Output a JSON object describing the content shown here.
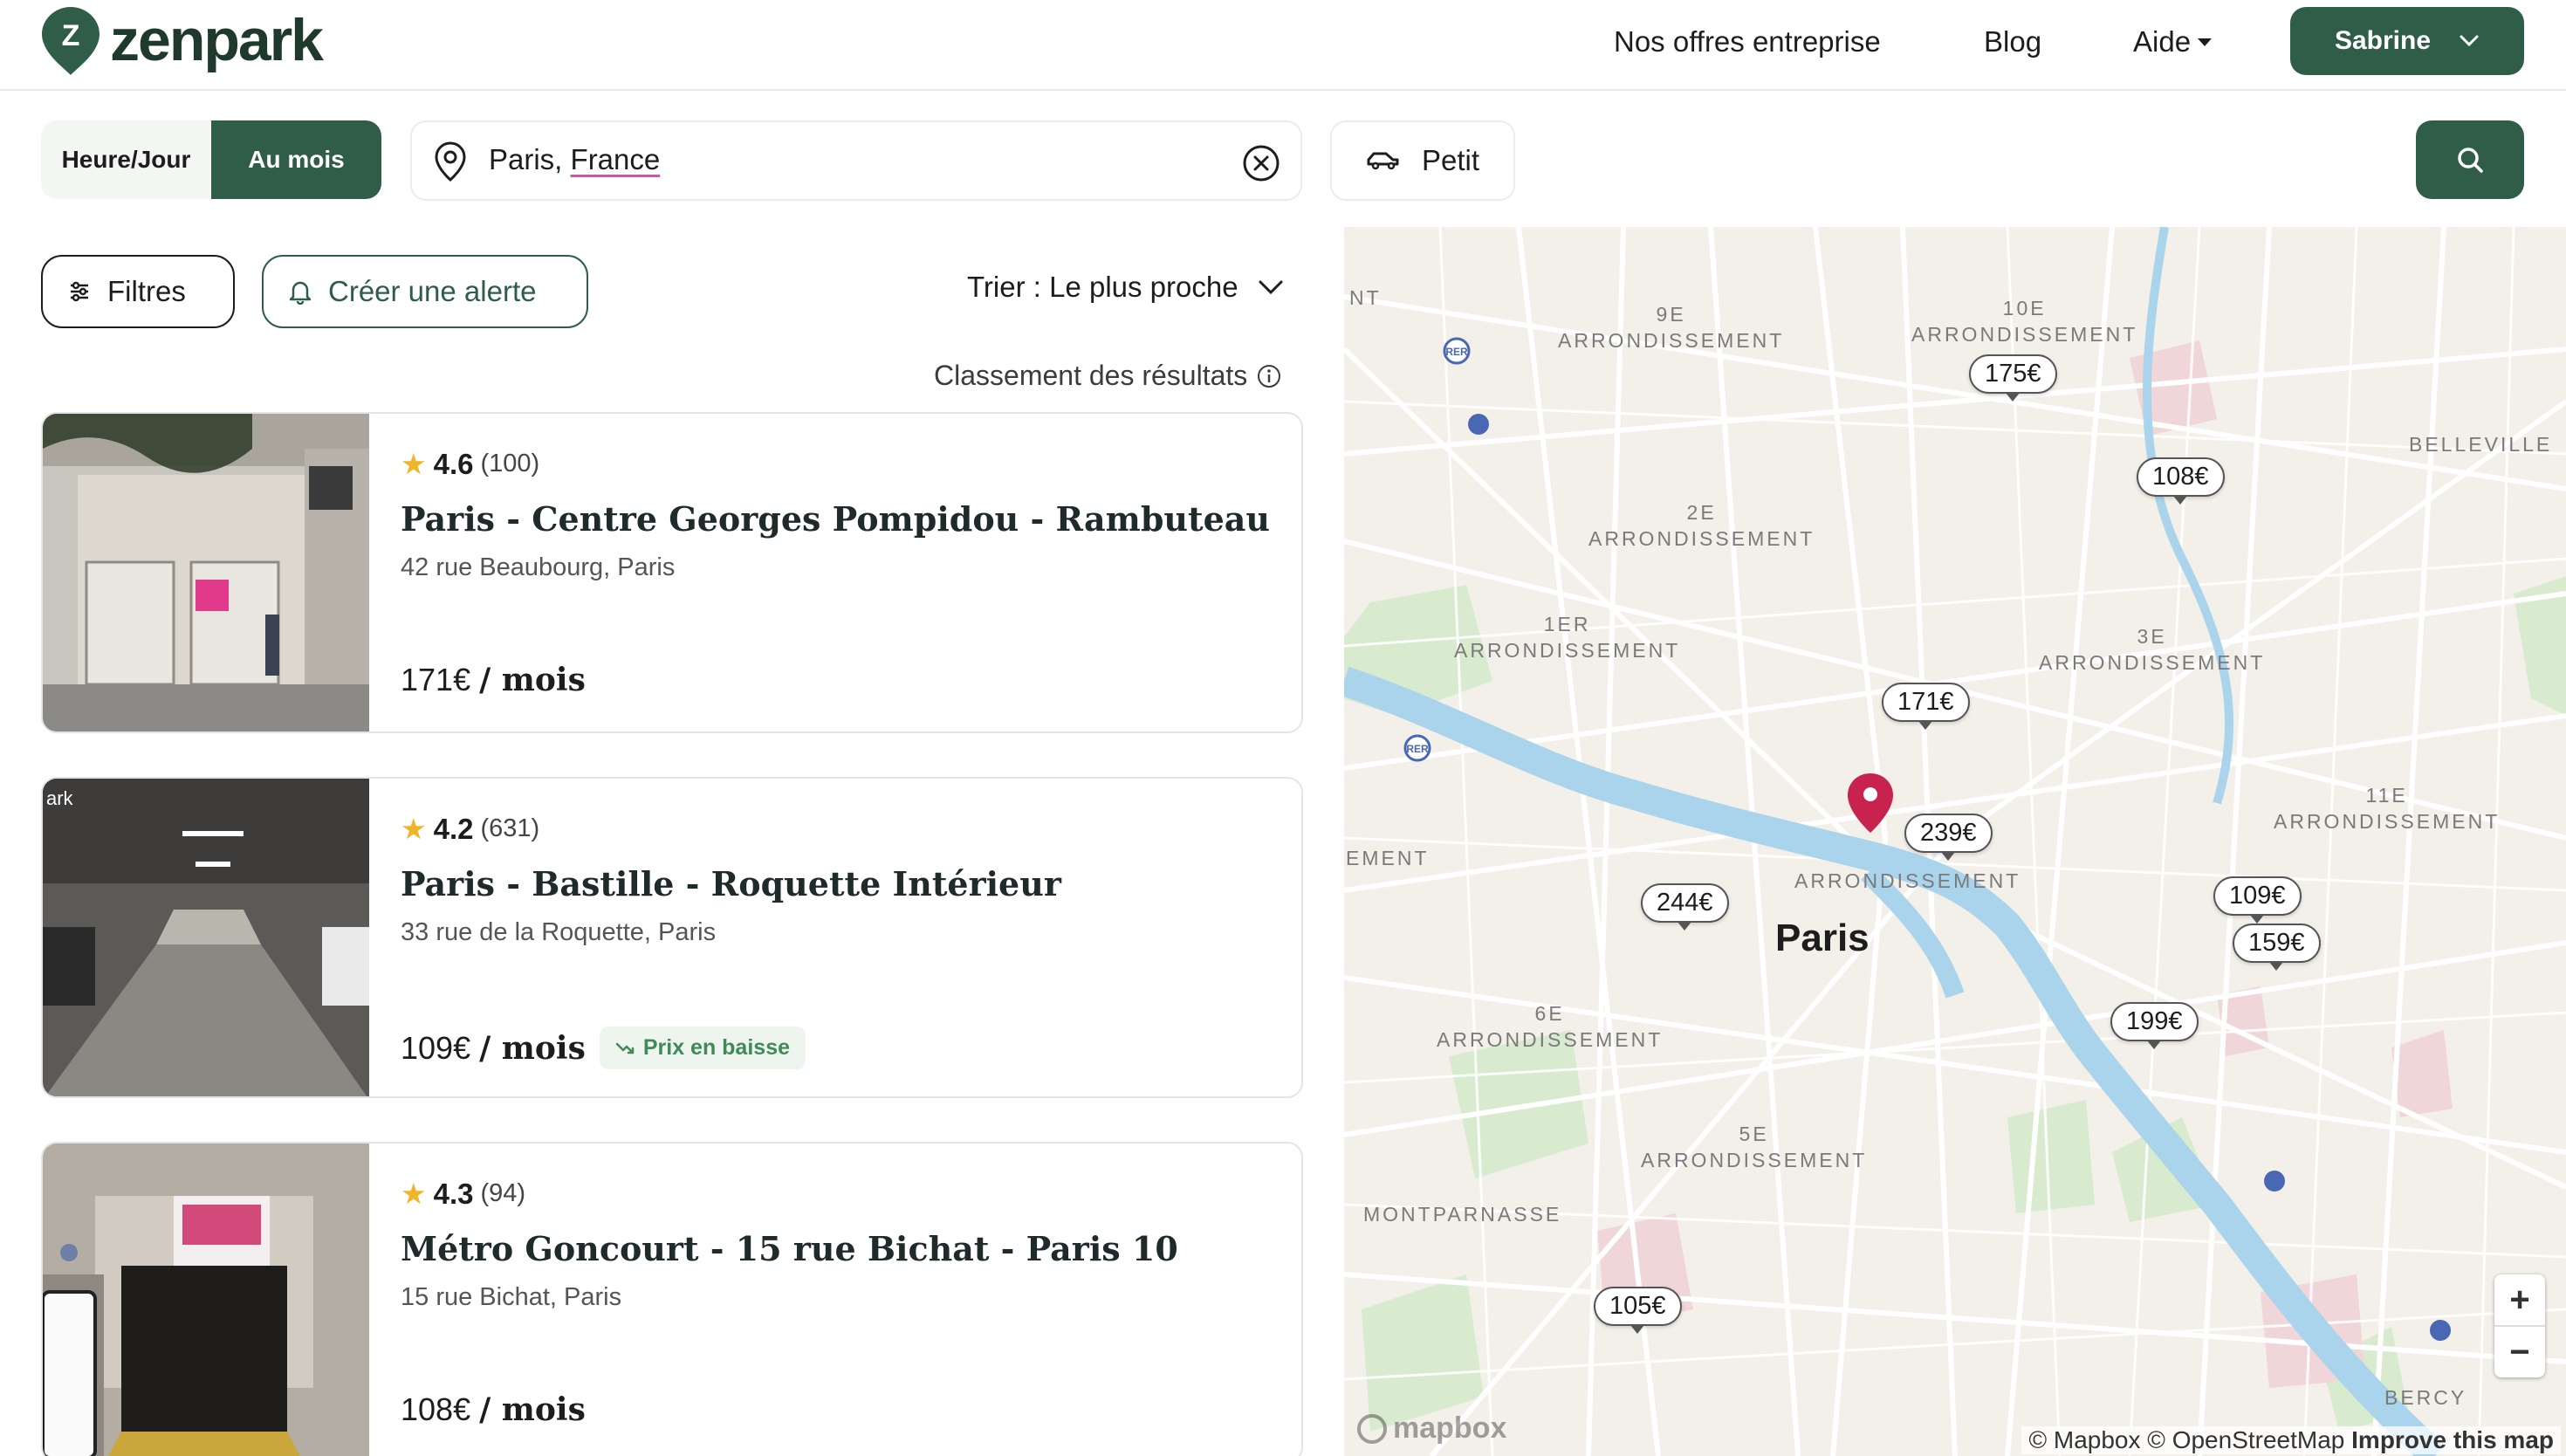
{
  "header": {
    "brand": "zenpark",
    "brand_letter": "Z",
    "nav": [
      "Nos offres entreprise",
      "Blog",
      "Aide"
    ],
    "user_name": "Sabrine"
  },
  "search": {
    "mode_hour": "Heure/Jour",
    "mode_month": "Au mois",
    "active_mode": "Au mois",
    "location_city": "Paris,",
    "location_country": "France",
    "vehicle": "Petit"
  },
  "filters": {
    "filters_label": "Filtres",
    "alert_label": "Créer une alerte",
    "sort_label": "Trier : Le plus proche",
    "ranking_label": "Classement des résultats"
  },
  "results": [
    {
      "rating": "4.6",
      "count": "(100)",
      "title": "Paris - Centre Georges Pompidou - Rambuteau",
      "address": "42 rue Beaubourg, Paris",
      "price": "171€",
      "per": "/ mois",
      "badge": ""
    },
    {
      "rating": "4.2",
      "count": "(631)",
      "title": "Paris - Bastille - Roquette Intérieur",
      "address": "33 rue de la Roquette, Paris",
      "price": "109€",
      "per": "/ mois",
      "badge": "Prix en baisse"
    },
    {
      "rating": "4.3",
      "count": "(94)",
      "title": "Métro Goncourt - 15 rue Bichat - Paris 10",
      "address": "15 rue Bichat, Paris",
      "price": "108€",
      "per": "/ mois",
      "badge": ""
    }
  ],
  "map": {
    "city": "Paris",
    "districts": [
      "9E\nARRONDISSEMENT",
      "10E\nARRONDISSEMENT",
      "2E\nARRONDISSEMENT",
      "1ER\nARRONDISSEMENT",
      "3E\nARRONDISSEMENT",
      "ARRONDISSEMENT",
      "11E\nARRONDISSEMENT",
      "6E\nARRONDISSEMENT",
      "5E\nARRONDISSEMENT",
      "MONTPARNASSE",
      "BELLEVILLE",
      "BERCY",
      "EMENT",
      "NT"
    ],
    "prices": [
      "175€",
      "108€",
      "171€",
      "239€",
      "244€",
      "109€",
      "159€",
      "199€",
      "105€"
    ],
    "zoom_in": "+",
    "zoom_out": "−",
    "attribution_a": "© Mapbox © OpenStreetMap",
    "attribution_b": "Improve this map",
    "watermark": "mapbox"
  },
  "colors": {
    "brand_green": "#2f5d48",
    "pin": "#c8224f",
    "river": "#a9d4ec"
  }
}
